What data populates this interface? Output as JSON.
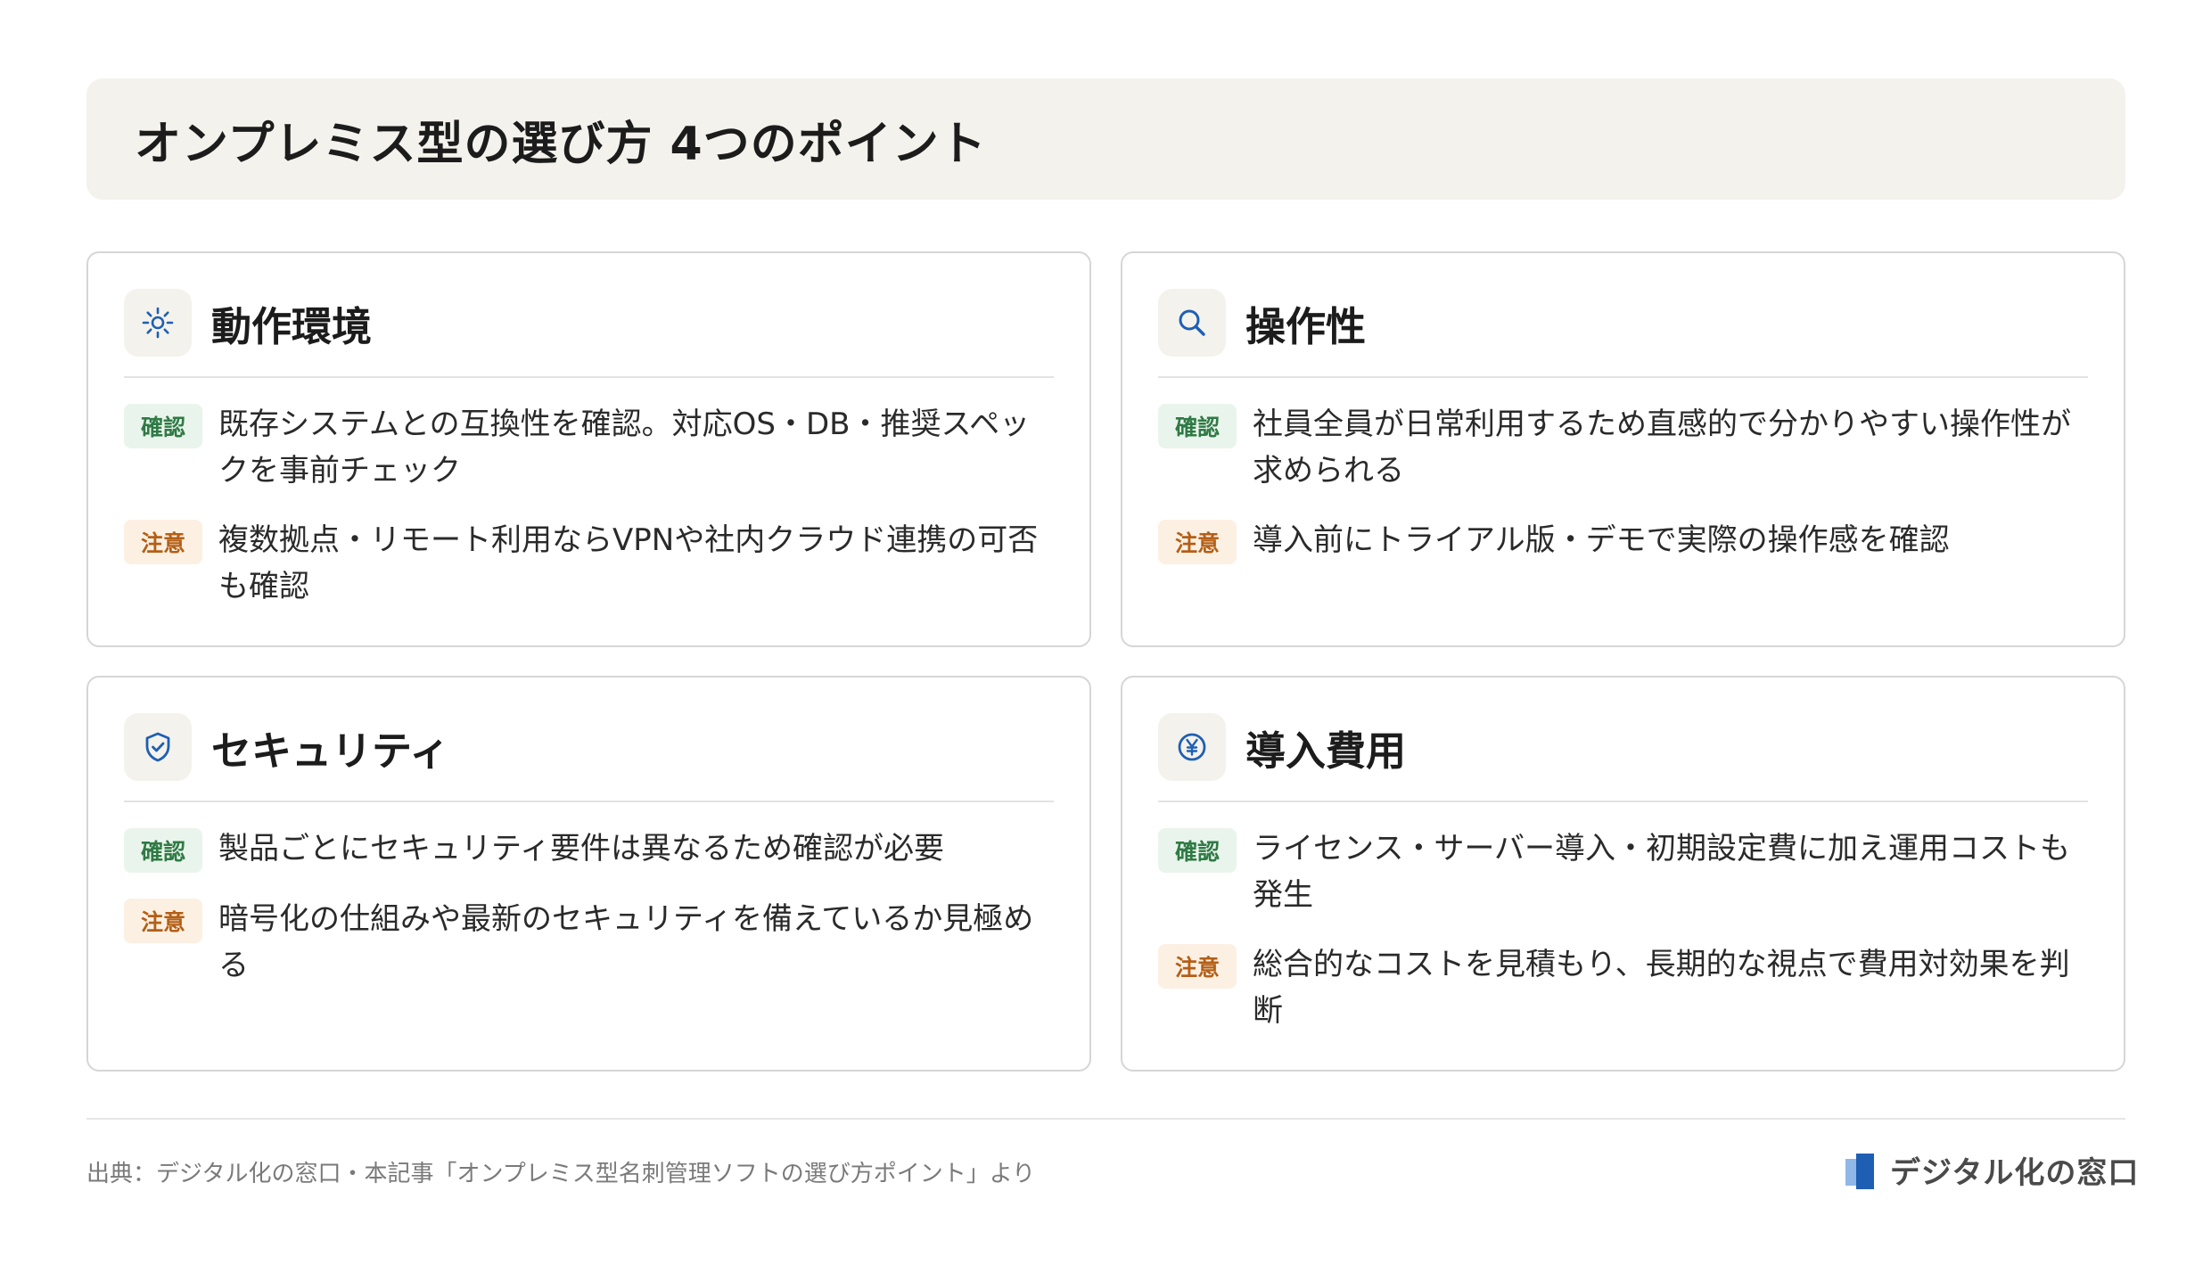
{
  "title": "オンプレミス型の選び方 4つのポイント",
  "cards": [
    {
      "icon": "gear-icon",
      "title": "動作環境",
      "rows": [
        {
          "badge": "確認",
          "text": "既存システムとの互換性を確認。対応OS・DB・推奨スペックを事前チェック"
        },
        {
          "badge": "注意",
          "text": "複数拠点・リモート利用ならVPNや社内クラウド連携の可否も確認"
        }
      ]
    },
    {
      "icon": "search-icon",
      "title": "操作性",
      "rows": [
        {
          "badge": "確認",
          "text": "社員全員が日常利用するため直感的で分かりやすい操作性が求められる"
        },
        {
          "badge": "注意",
          "text": "導入前にトライアル版・デモで実際の操作感を確認"
        }
      ]
    },
    {
      "icon": "shield-check-icon",
      "title": "セキュリティ",
      "rows": [
        {
          "badge": "確認",
          "text": "製品ごとにセキュリティ要件は異なるため確認が必要"
        },
        {
          "badge": "注意",
          "text": "暗号化の仕組みや最新のセキュリティを備えているか見極める"
        }
      ]
    },
    {
      "icon": "yen-icon",
      "title": "導入費用",
      "rows": [
        {
          "badge": "確認",
          "text": "ライセンス・サーバー導入・初期設定費に加え運用コストも発生"
        },
        {
          "badge": "注意",
          "text": "総合的なコストを見積もり、長期的な視点で費用対効果を判断"
        }
      ]
    }
  ],
  "footer": {
    "source": "出典：デジタル化の窓口・本記事「オンプレミス型名刺管理ソフトの選び方ポイント」より",
    "logo_text": "デジタル化の窓口"
  },
  "colors": {
    "title_bg": "#f4f2ec",
    "confirm_bg": "#e9f5ec",
    "confirm_text": "#2f7a45",
    "caution_bg": "#fcf0e3",
    "caution_text": "#b45f16",
    "icon_blue": "#1e5fb4"
  }
}
